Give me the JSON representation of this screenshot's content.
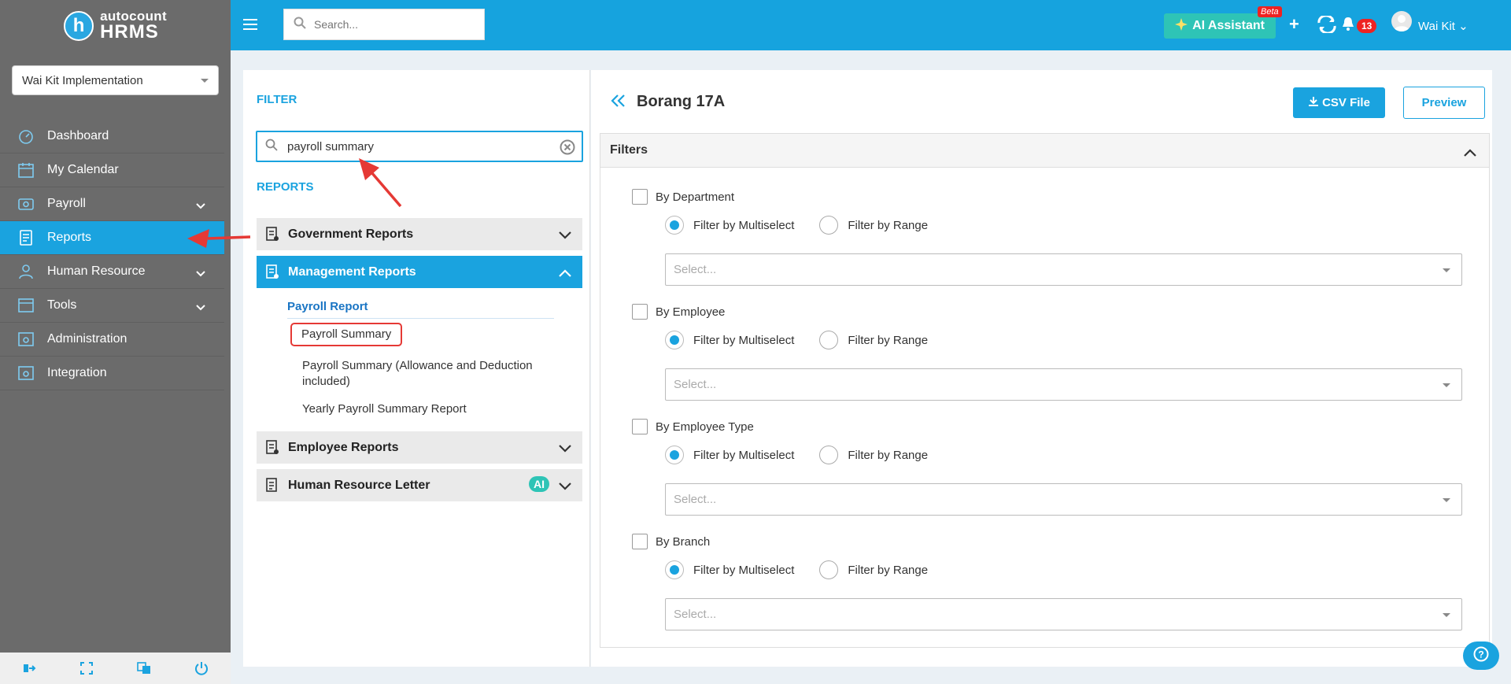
{
  "sidebar": {
    "logo_top": "autocount",
    "logo_bottom": "HRMS",
    "logo_letter": "h",
    "company": "Wai Kit Implementation",
    "items": [
      {
        "label": "Dashboard",
        "icon": "dashboard-icon"
      },
      {
        "label": "My Calendar",
        "icon": "calendar-icon"
      },
      {
        "label": "Payroll",
        "icon": "payroll-icon"
      },
      {
        "label": "Reports",
        "icon": "reports-icon"
      },
      {
        "label": "Human Resource",
        "icon": "human-resource-icon"
      },
      {
        "label": "Tools",
        "icon": "tools-icon"
      },
      {
        "label": "Administration",
        "icon": "administration-icon"
      },
      {
        "label": "Integration",
        "icon": "integration-icon"
      }
    ],
    "active_index": 3
  },
  "topbar": {
    "search_placeholder": "Search...",
    "ai_label": "AI Assistant",
    "beta": "Beta",
    "notification_count": "13",
    "user_name": "Wai Kit"
  },
  "left": {
    "filter_title": "FILTER",
    "search_value": "payroll summary",
    "reports_title": "REPORTS",
    "groups": {
      "government": "Government Reports",
      "management": "Management Reports",
      "employee": "Employee Reports",
      "hr_letter": "Human Resource Letter"
    },
    "ai_chip": "AI",
    "subsection": "Payroll Report",
    "items": [
      "Payroll Summary",
      "Payroll Summary (Allowance and Deduction",
      "included)",
      "Yearly Payroll Summary Report"
    ]
  },
  "right": {
    "title": "Borang 17A",
    "csv_label": "CSV File",
    "preview_label": "Preview",
    "filters_title": "Filters",
    "multiselect_label": "Filter by Multiselect",
    "range_label": "Filter by Range",
    "select_placeholder": "Select...",
    "groups": [
      {
        "label": "By Department"
      },
      {
        "label": "By Employee"
      },
      {
        "label": "By Employee Type"
      },
      {
        "label": "By Branch"
      }
    ]
  },
  "colors": {
    "primary": "#1aa3df",
    "sidebar": "#6b6b6b",
    "ai": "#2ec4b6",
    "alert": "#e22222"
  }
}
